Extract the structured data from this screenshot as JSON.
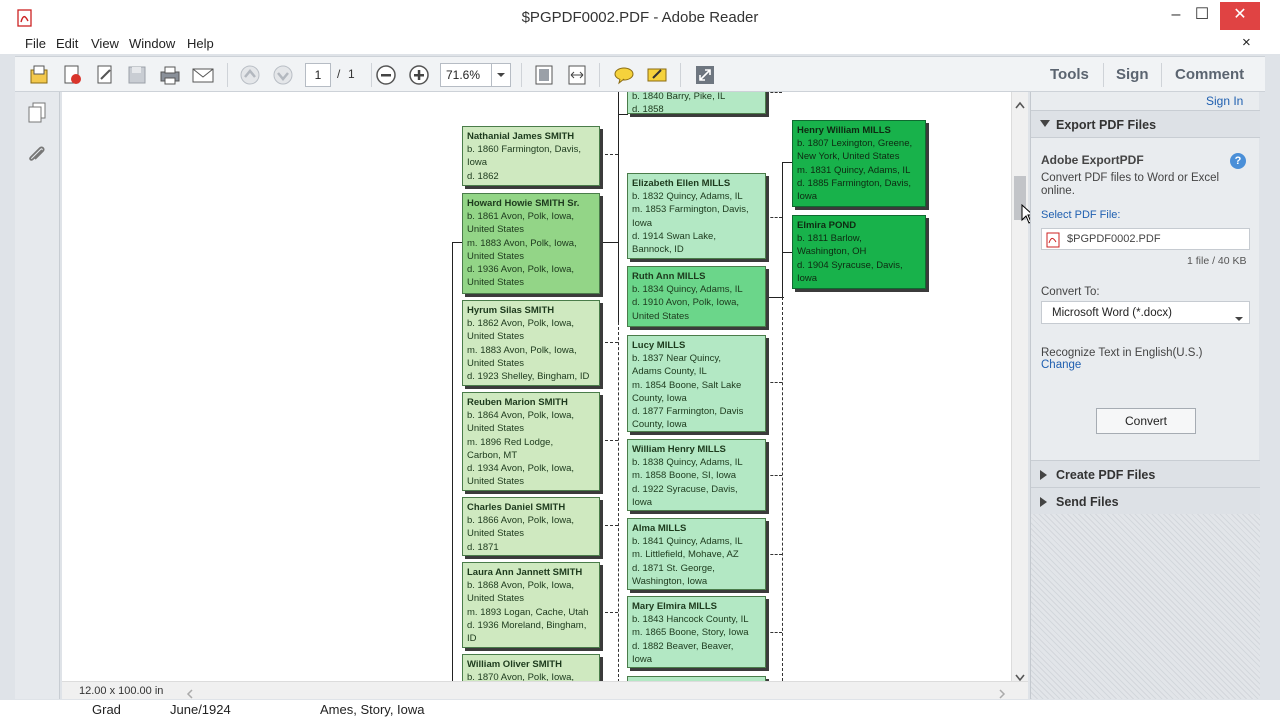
{
  "window": {
    "title": "$PGPDF0002.PDF - Adobe Reader",
    "minimize": "–",
    "maximize": "☐",
    "close": "✕"
  },
  "menubar": {
    "items": [
      "File",
      "Edit",
      "View",
      "Window",
      "Help"
    ],
    "close_doc": "×"
  },
  "toolbar": {
    "page_current": "1",
    "page_sep": "/",
    "page_total": "1",
    "zoom": "71.6%",
    "pane_links": [
      "Tools",
      "Sign",
      "Comment"
    ]
  },
  "document": {
    "size_label": "12.00 x 100.00 in",
    "cards": [
      {
        "id": "top-partial",
        "lines": [
          "b. 1840 Barry, Pike, IL",
          "d. 1858"
        ]
      },
      {
        "id": "nathanial",
        "name": "Nathanial James SMITH",
        "lines": [
          "b. 1860 Farmington, Davis,",
          "Iowa",
          "d. 1862"
        ]
      },
      {
        "id": "howard",
        "name": "Howard Howie SMITH Sr.",
        "lines": [
          "b. 1861 Avon, Polk, Iowa,",
          "United States",
          "m. 1883 Avon, Polk, Iowa,",
          "United States",
          "d. 1936 Avon, Polk, Iowa,",
          "United States"
        ]
      },
      {
        "id": "hyrum",
        "name": "Hyrum Silas SMITH",
        "lines": [
          "b. 1862 Avon, Polk, Iowa,",
          "United States",
          "m. 1883 Avon, Polk, Iowa,",
          "United States",
          "d. 1923 Shelley, Bingham, ID"
        ]
      },
      {
        "id": "reuben",
        "name": "Reuben Marion SMITH",
        "lines": [
          "b. 1864 Avon, Polk, Iowa,",
          "United States",
          "m. 1896 Red Lodge,",
          "Carbon, MT",
          "d. 1934 Avon, Polk, Iowa,",
          "United States"
        ]
      },
      {
        "id": "charles",
        "name": "Charles Daniel SMITH",
        "lines": [
          "b. 1866 Avon, Polk, Iowa,",
          "United States",
          "d. 1871"
        ]
      },
      {
        "id": "laura",
        "name": "Laura Ann Jannett SMITH",
        "lines": [
          "b. 1868 Avon, Polk, Iowa,",
          "United States",
          "m. 1893 Logan, Cache, Utah",
          "d. 1936 Moreland, Bingham,",
          "ID"
        ]
      },
      {
        "id": "william-oliver",
        "name": "William Oliver SMITH",
        "lines": [
          "b. 1870 Avon, Polk, Iowa,"
        ]
      },
      {
        "id": "elizabeth",
        "name": "Elizabeth Ellen MILLS",
        "lines": [
          "b. 1832 Quincy, Adams, IL",
          "m. 1853 Farmington, Davis,",
          "Iowa",
          "d. 1914 Swan Lake,",
          "Bannock, ID"
        ]
      },
      {
        "id": "ruth",
        "name": "Ruth Ann MILLS",
        "lines": [
          "b. 1834 Quincy, Adams, IL",
          "d. 1910 Avon, Polk, Iowa,",
          "United States"
        ]
      },
      {
        "id": "lucy",
        "name": "Lucy MILLS",
        "lines": [
          "b. 1837 Near Quincy,",
          "Adams County, IL",
          "m. 1854 Boone, Salt Lake",
          "County, Iowa",
          "d. 1877 Farmington, Davis",
          "County, Iowa"
        ]
      },
      {
        "id": "william-henry",
        "name": "William Henry MILLS",
        "lines": [
          "b. 1838 Quincy, Adams, IL",
          "m. 1858 Boone, SI, Iowa",
          "d. 1922 Syracuse, Davis,",
          "Iowa"
        ]
      },
      {
        "id": "alma",
        "name": "Alma MILLS",
        "lines": [
          "b. 1841 Quincy, Adams, IL",
          "m.  Littlefield, Mohave, AZ",
          "d. 1871 St. George,",
          "Washington, Iowa"
        ]
      },
      {
        "id": "mary",
        "name": "Mary Elmira MILLS",
        "lines": [
          "b. 1843 Hancock County, IL",
          "m. 1865 Boone, Story, Iowa",
          "d. 1882 Beaver, Beaver,",
          "Iowa"
        ]
      },
      {
        "id": "bottom-partial",
        "name": "",
        "lines": []
      },
      {
        "id": "henry",
        "name": "Henry William MILLS",
        "lines": [
          "b. 1807 Lexington, Greene,",
          "New York, United States",
          "m. 1831 Quincy, Adams, IL",
          "d. 1885 Farmington, Davis,",
          "Iowa"
        ]
      },
      {
        "id": "elmira",
        "name": "Elmira POND",
        "lines": [
          "b. 1811 Barlow,",
          "Washington, OH",
          "d. 1904 Syracuse, Davis,",
          "Iowa"
        ]
      }
    ]
  },
  "right_panel": {
    "sign_in": "Sign In",
    "export_header": "Export PDF Files",
    "service_title": "Adobe ExportPDF",
    "help_icon": "?",
    "description": "Convert PDF files to Word or Excel online.",
    "select_label": "Select PDF File:",
    "file_name": "$PGPDF0002.PDF",
    "file_info": "1 file / 40 KB",
    "convert_to_label": "Convert To:",
    "convert_to_value": "Microsoft Word (*.docx)",
    "ocr_text": "Recognize Text in English(U.S.)",
    "change_link": "Change",
    "convert_button": "Convert",
    "create_header": "Create PDF Files",
    "send_header": "Send Files"
  },
  "bottom_strip": {
    "cells": [
      "Grad",
      "June/1924",
      "Ames, Story, Iowa"
    ]
  },
  "colors": {
    "accent_blue": "#1f5fb0",
    "card_green_light": "#cfe9c0",
    "card_green_dark": "#18b24b"
  }
}
